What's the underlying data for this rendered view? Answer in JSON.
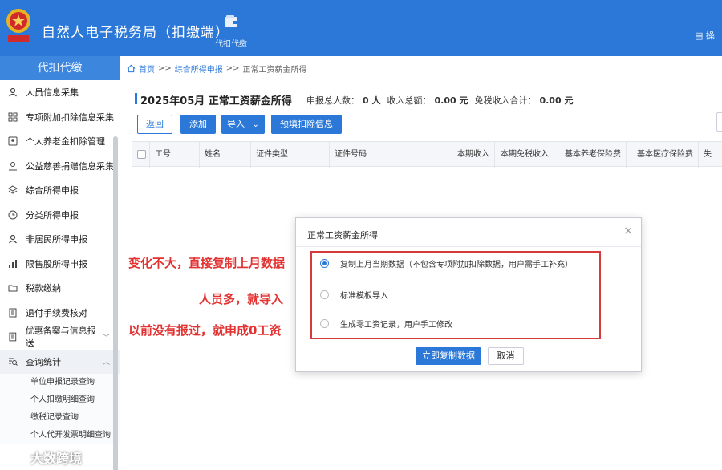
{
  "header": {
    "app_title": "自然人电子税务局（扣缴端）",
    "nav_label": "代扣代缴",
    "right_text": "操"
  },
  "sidebar": {
    "heading": "代扣代缴",
    "items": [
      {
        "label": "人员信息采集",
        "icon": "person-icon"
      },
      {
        "label": "专项附加扣除信息采集",
        "icon": "grid-icon"
      },
      {
        "label": "个人养老金扣除管理",
        "icon": "contact-card-icon"
      },
      {
        "label": "公益慈善捐赠信息采集",
        "icon": "charity-icon"
      },
      {
        "label": "综合所得申报",
        "icon": "layers-icon"
      },
      {
        "label": "分类所得申报",
        "icon": "clock-icon"
      },
      {
        "label": "非居民所得申报",
        "icon": "person-icon"
      },
      {
        "label": "限售股所得申报",
        "icon": "bar-chart-icon"
      },
      {
        "label": "税款缴纳",
        "icon": "folder-icon"
      },
      {
        "label": "退付手续费核对",
        "icon": "document-icon"
      },
      {
        "label": "优惠备案与信息报送",
        "icon": "document-icon"
      },
      {
        "label": "查询统计",
        "icon": "search-list-icon"
      }
    ],
    "subitems": [
      "单位申报记录查询",
      "个人扣缴明细查询",
      "缴税记录查询",
      "个人代开发票明细查询"
    ]
  },
  "breadcrumb": {
    "home": "首页",
    "sep": ">>",
    "mid": "综合所得申报",
    "current": "正常工资薪金所得"
  },
  "page": {
    "title": "2025年05月 正常工资薪金所得",
    "stat1_label": "申报总人数：",
    "stat1_value": "0 人",
    "stat2_label": "收入总额：",
    "stat2_value": "0.00 元",
    "stat3_label": "免税收入合计：",
    "stat3_value": "0.00 元"
  },
  "toolbar": {
    "back": "返回",
    "add": "添加",
    "import": "导入",
    "import_caret": "⌄",
    "prefill": "预填扣除信息"
  },
  "table": {
    "columns": [
      "工号",
      "姓名",
      "证件类型",
      "证件号码",
      "本期收入",
      "本期免税收入",
      "基本养老保险费",
      "基本医疗保险费",
      "失"
    ]
  },
  "annotations": [
    "变化不大，直接复制上月数据",
    "人员多，就导入",
    "以前没有报过，就申成0工资"
  ],
  "dialog": {
    "title": "正常工资薪金所得",
    "close": "×",
    "options": [
      "复制上月当期数据（不包含专项附加扣除数据，用户需手工补充）",
      "标准模板导入",
      "生成零工资记录，用户手工修改"
    ],
    "selected_index": 0,
    "confirm": "立即复制数据",
    "cancel": "取消"
  },
  "watermark": {
    "text": "大数跨境"
  },
  "colors": {
    "brand_blue": "#2b78d8",
    "annotation_red": "#e23232"
  }
}
